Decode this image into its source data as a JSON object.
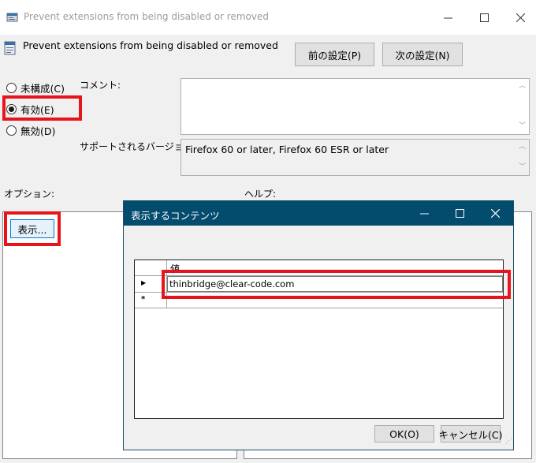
{
  "window": {
    "title": "Prevent extensions from being disabled or removed",
    "policy_title": "Prevent extensions from being disabled or removed",
    "prev_button": "前の設定(P)",
    "next_button": "次の設定(N)"
  },
  "state": {
    "options": [
      "未構成(C)",
      "有効(E)",
      "無効(D)"
    ],
    "selected": "有効(E)"
  },
  "comment": {
    "label": "コメント:",
    "value": ""
  },
  "supported": {
    "label": "サポートされるバージョン:",
    "value": "Firefox 60 or later, Firefox 60 ESR or later"
  },
  "options_section": {
    "label": "オプション:",
    "show_button": "表示..."
  },
  "help_section": {
    "label": "ヘルプ:"
  },
  "dialog": {
    "title": "表示するコンテンツ",
    "column_header": "値",
    "rows": [
      {
        "indicator": "▶",
        "value": "thinbridge@clear-code.com"
      },
      {
        "indicator": "*",
        "value": ""
      }
    ],
    "ok_button": "OK(O)",
    "cancel_button": "キャンセル(C)"
  },
  "colors": {
    "dialog_title_bg": "#034c6d",
    "highlight": "#e8141c"
  }
}
